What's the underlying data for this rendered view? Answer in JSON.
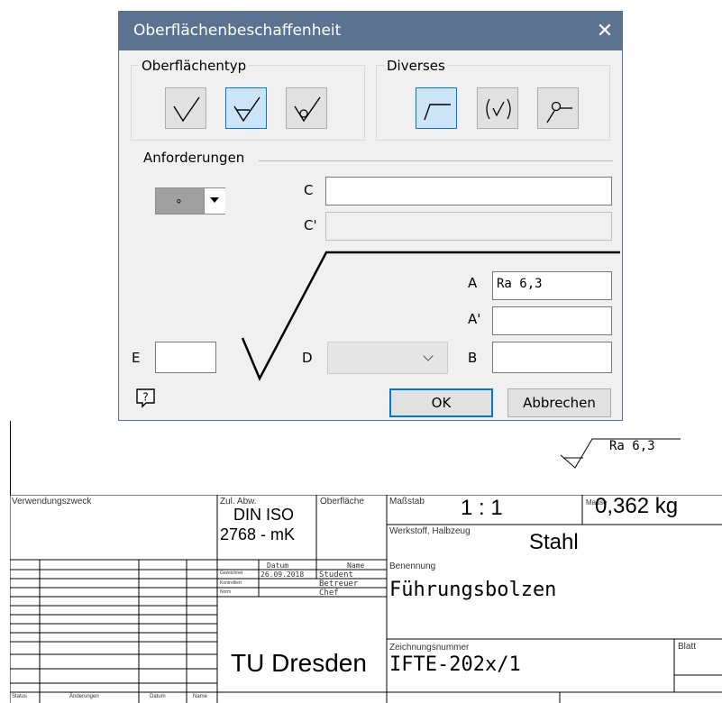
{
  "dialog": {
    "title": "Oberflächenbeschaffenheit",
    "close_icon": "close-icon",
    "surface_type": {
      "legend": "Oberflächentyp",
      "buttons": [
        {
          "icon": "basic-surface-symbol-icon",
          "selected": false
        },
        {
          "icon": "material-removal-required-icon",
          "selected": true
        },
        {
          "icon": "material-removal-prohibited-icon",
          "selected": false
        }
      ]
    },
    "misc": {
      "legend": "Diverses",
      "buttons": [
        {
          "icon": "long-extension-icon",
          "selected": true
        },
        {
          "icon": "parenthesized-symbol-icon",
          "selected": false
        },
        {
          "icon": "all-around-icon",
          "selected": false
        }
      ]
    },
    "requirements": {
      "legend": "Anforderungen",
      "lay_symbol": "∘",
      "label_c": "C",
      "label_c_prime": "C'",
      "label_a": "A",
      "label_a_prime": "A'",
      "label_b": "B",
      "label_d": "D",
      "label_e": "E",
      "value_c": "",
      "value_c_prime": "",
      "value_a": "Ra 6,3",
      "value_a_prime": "",
      "value_b": "",
      "value_d": "",
      "value_e": ""
    },
    "help_icon": "help-icon",
    "ok_label": "OK",
    "cancel_label": "Abbrechen",
    "accent_color": "#0078d7",
    "titlebar_color": "#5b7391"
  },
  "drawing": {
    "surface_annotation": "Ra 6,3",
    "title_block": {
      "verwendungszweck_label": "Verwendungszweck",
      "zul_abw_label": "Zul. Abw.",
      "zul_abw_line1": "DIN ISO",
      "zul_abw_line2": "2768 - mK",
      "oberflaeche_label": "Oberfläche",
      "massstab_label": "Maßstab",
      "massstab_value": "1 : 1",
      "masse_label": "Masse",
      "masse_value": "0,362 kg",
      "werkstoff_label": "Werkstoff, Halbzeug",
      "werkstoff_value": "Stahl",
      "datum_header": "Datum",
      "name_header": "Name",
      "gezeichnet_label": "Gezeichnet",
      "gezeichnet_datum": "26.09.2018",
      "gezeichnet_name": "Student",
      "kontrolliert_label": "Kontrolliert",
      "kontrolliert_name": "Betreuer",
      "norm_label": "Norm",
      "norm_name": "Chef",
      "benennung_label": "Benennung",
      "benennung_value": "Führungsbolzen",
      "institution": "TU Dresden",
      "zeichnungsnummer_label": "Zeichnungsnummer",
      "zeichnungsnummer_value": "IFTE-202x/1",
      "blatt_label": "Blatt",
      "status_label": "Status",
      "aenderungen_label": "Änderungen",
      "datum_label": "Datum",
      "name_label": "Name"
    }
  }
}
